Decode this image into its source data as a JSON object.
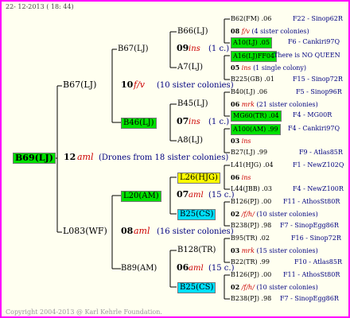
{
  "header": {
    "date": "22- 12-2013 ( 18: 44)"
  },
  "footer": {
    "copyright": "Copyright 2004-2013 @ Karl Kehrle Foundation."
  },
  "colors": {
    "frame": "#ff00ff",
    "highlight_green": "#00e000",
    "highlight_yellow": "#ffff00",
    "highlight_cyan": "#00e0ff",
    "year_text": "#cc0000",
    "pedigree_text": "#000080"
  },
  "root": {
    "id": "B69(LJ)",
    "year": "12",
    "mating": "aml",
    "note": "(Drones from 18 sister colonies)"
  },
  "gen1": {
    "sire_side": {
      "id": "B67(LJ)",
      "year": "10",
      "mating": "f/v",
      "note": "(10 sister colonies)"
    },
    "dam_side": {
      "id": "L083(WF)",
      "year": "08",
      "mating": "aml",
      "note": "(16 sister colonies)"
    }
  },
  "gen2": {
    "a": {
      "id": "B67(LJ)",
      "year": "09",
      "mating": "ins",
      "note": "(1 c.)"
    },
    "b": {
      "id": "B46(LJ)",
      "year": "07",
      "mating": "ins",
      "note": "(1 c.)"
    },
    "c": {
      "id": "L20(AM)",
      "year": "07",
      "mating": "aml",
      "note": "(15 c.)"
    },
    "d": {
      "id": "B89(AM)",
      "year": "06",
      "mating": "aml",
      "note": "(15 c.)"
    }
  },
  "gen3": {
    "a1": "B66(LJ)",
    "a2": "A7(LJ)",
    "b1": "B45(LJ)",
    "b2": "A8(LJ)",
    "c1": "L26(HJG)",
    "c2": "B25(CS)",
    "d1": "B128(TR)",
    "d2": "B25(CS)"
  },
  "gen4": [
    {
      "id": "B62(FM)",
      "year": ".06",
      "ref": "F22 - Sinop62R"
    },
    {
      "year": "08",
      "mating": "f/v",
      "note": "(4 sister colonies)"
    },
    {
      "id": "A10(LJ)",
      "year": ".05",
      "ref": "F6 - Cankiri97Q"
    },
    {
      "id": "A16(LJ)FF",
      "year": "04",
      "ref": "There is NO QUEEN"
    },
    {
      "year": "05",
      "mating": "ins",
      "note": "(1 single colony)"
    },
    {
      "id": "B225(GB)",
      "year": ".01",
      "ref": "F15 - Sinop72R"
    },
    {
      "id": "B40(LJ)",
      "year": ".06",
      "ref": "F5 - Sinop96R"
    },
    {
      "year": "06",
      "mating": "mrk",
      "note": "(21 sister colonies)"
    },
    {
      "id": "MG60(TR)",
      "year": ".04",
      "ref": "F4 - MG00R"
    },
    {
      "id": "A100(AM)",
      "year": ".99",
      "ref": "F4 - Cankiri97Q"
    },
    {
      "year": "03",
      "mating": "ins",
      "note": ""
    },
    {
      "id": "B27(LJ)",
      "year": ".99",
      "ref": "F9 - Atlas85R"
    },
    {
      "id": "L41(HJG)",
      "year": ".04",
      "ref": "F1 - NewZ102Q"
    },
    {
      "year": "06",
      "mating": "ins",
      "note": ""
    },
    {
      "id": "L44(JBB)",
      "year": ".03",
      "ref": "F4 - NewZ100R"
    },
    {
      "id": "B126(PJ)",
      "year": ".00",
      "ref": "F11 - AthosSt80R"
    },
    {
      "year": "02",
      "mating": "/f/h/",
      "note": "(10 sister colonies)"
    },
    {
      "id": "B238(PJ)",
      "year": ".98",
      "ref": "F7 - SinopEgg86R"
    },
    {
      "id": "B95(TR)",
      "year": ".02",
      "ref": "F16 - Sinop72R"
    },
    {
      "year": "03",
      "mating": "mrk",
      "note": "(15 sister colonies)"
    },
    {
      "id": "B22(TR)",
      "year": ".99",
      "ref": "F10 - Atlas85R"
    },
    {
      "id": "B126(PJ)",
      "year": ".00",
      "ref": "F11 - AthosSt80R"
    },
    {
      "year": "02",
      "mating": "/f/h/",
      "note": "(10 sister colonies)"
    },
    {
      "id": "B238(PJ)",
      "year": ".98",
      "ref": "F7 - SinopEgg86R"
    }
  ]
}
